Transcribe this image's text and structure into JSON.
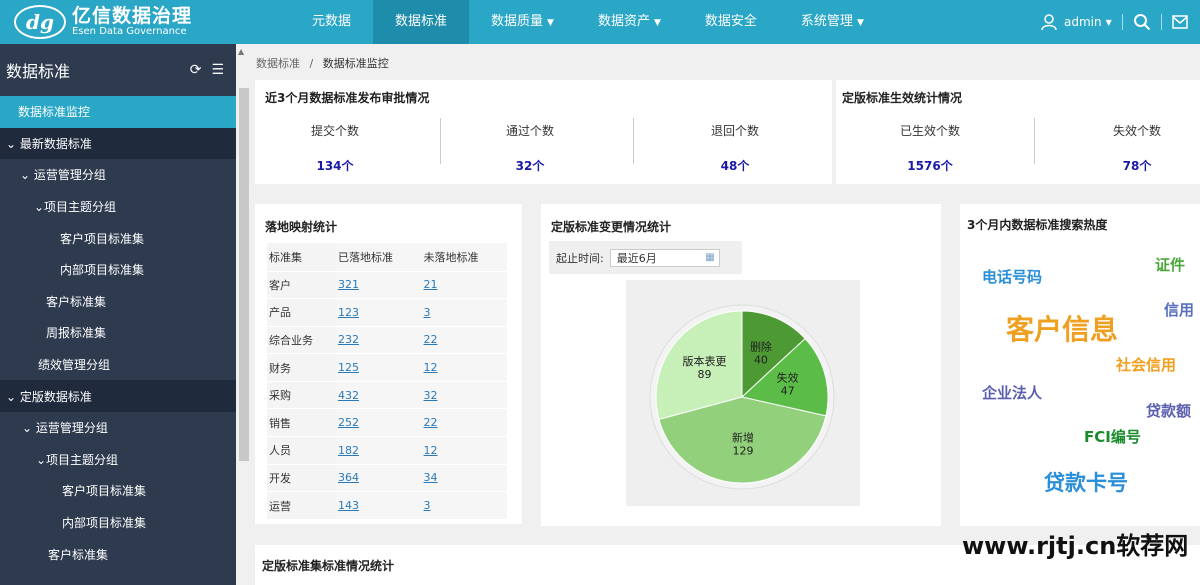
{
  "brand": {
    "mark": "dg",
    "name_cn": "亿信数据治理",
    "name_en": "Esen Data Governance"
  },
  "nav": [
    {
      "label": "元数据",
      "dropdown": false,
      "active": false
    },
    {
      "label": "数据标准",
      "dropdown": false,
      "active": true
    },
    {
      "label": "数据质量",
      "dropdown": true,
      "active": false
    },
    {
      "label": "数据资产",
      "dropdown": true,
      "active": false
    },
    {
      "label": "数据安全",
      "dropdown": false,
      "active": false
    },
    {
      "label": "系统管理",
      "dropdown": true,
      "active": false
    }
  ],
  "user": {
    "name": "admin"
  },
  "sidebar": {
    "title": "数据标准",
    "items": [
      {
        "label": "数据标准监控",
        "indent": 18,
        "type": "active"
      },
      {
        "label": "⌄ 最新数据标准",
        "indent": 6,
        "type": "group"
      },
      {
        "label": "⌄ 运营管理分组",
        "indent": 20,
        "type": "item"
      },
      {
        "label": "⌄项目主题分组",
        "indent": 34,
        "type": "item"
      },
      {
        "label": "客户项目标准集",
        "indent": 60,
        "type": "item"
      },
      {
        "label": "内部项目标准集",
        "indent": 60,
        "type": "item"
      },
      {
        "label": "客户标准集",
        "indent": 46,
        "type": "item"
      },
      {
        "label": "周报标准集",
        "indent": 46,
        "type": "item"
      },
      {
        "label": "绩效管理分组",
        "indent": 38,
        "type": "item"
      },
      {
        "label": "⌄ 定版数据标准",
        "indent": 6,
        "type": "group"
      },
      {
        "label": "⌄ 运营管理分组",
        "indent": 22,
        "type": "item"
      },
      {
        "label": "⌄项目主题分组",
        "indent": 36,
        "type": "item"
      },
      {
        "label": "客户项目标准集",
        "indent": 62,
        "type": "item"
      },
      {
        "label": "内部项目标准集",
        "indent": 62,
        "type": "item"
      },
      {
        "label": "客户标准集",
        "indent": 48,
        "type": "item"
      }
    ]
  },
  "breadcrumb": {
    "parent": "数据标准",
    "separator": "/",
    "current": "数据标准监控"
  },
  "approval": {
    "title": "近3个月数据标准发布审批情况",
    "stats": [
      {
        "label": "提交个数",
        "value": "134个"
      },
      {
        "label": "通过个数",
        "value": "32个"
      },
      {
        "label": "退回个数",
        "value": "48个"
      }
    ]
  },
  "effect": {
    "title": "定版标准生效统计情况",
    "stats": [
      {
        "label": "已生效个数",
        "value": "1576个"
      },
      {
        "label": "失效个数",
        "value": "78个"
      }
    ]
  },
  "mapping": {
    "title": "落地映射统计",
    "headers": [
      "标准集",
      "已落地标准",
      "未落地标准"
    ],
    "rows": [
      [
        "客户",
        "321",
        "21"
      ],
      [
        "产品",
        "123",
        "3"
      ],
      [
        "综合业务",
        "232",
        "22"
      ],
      [
        "财务",
        "125",
        "12"
      ],
      [
        "采购",
        "432",
        "32"
      ],
      [
        "销售",
        "252",
        "22"
      ],
      [
        "人员",
        "182",
        "12"
      ],
      [
        "开发",
        "364",
        "34"
      ],
      [
        "运营",
        "143",
        "3"
      ]
    ]
  },
  "change": {
    "title": "定版标准变更情况统计",
    "date_label": "起止时间:",
    "date_value": "最近6月",
    "calendar_icon": "calendar-icon"
  },
  "chart_data": {
    "type": "pie",
    "categories": [
      "删除",
      "失效",
      "新增",
      "版本表更"
    ],
    "values": [
      40,
      47,
      129,
      89
    ],
    "colors": [
      "#4d9a34",
      "#5bbd47",
      "#93d07c",
      "#c7f0b9"
    ]
  },
  "hot": {
    "title": "3个月内数据标准搜索热度",
    "words": [
      {
        "text": "电话号码",
        "color": "#2a8fd8"
      },
      {
        "text": "证件",
        "color": "#4aa83a"
      },
      {
        "text": "客户信息",
        "color": "#f0a020"
      },
      {
        "text": "信用",
        "color": "#5a6fc0"
      },
      {
        "text": "社会信用",
        "color": "#f0a020"
      },
      {
        "text": "企业法人",
        "color": "#5a5fb0"
      },
      {
        "text": "贷款额",
        "color": "#5a5fb0"
      },
      {
        "text": "FCI编号",
        "color": "#1a8a2a"
      },
      {
        "text": "贷款卡号",
        "color": "#2a8fd8"
      }
    ]
  },
  "bottom": {
    "title": "定版标准集标准情况统计"
  },
  "watermark": "www.rjtj.cn软荐网"
}
